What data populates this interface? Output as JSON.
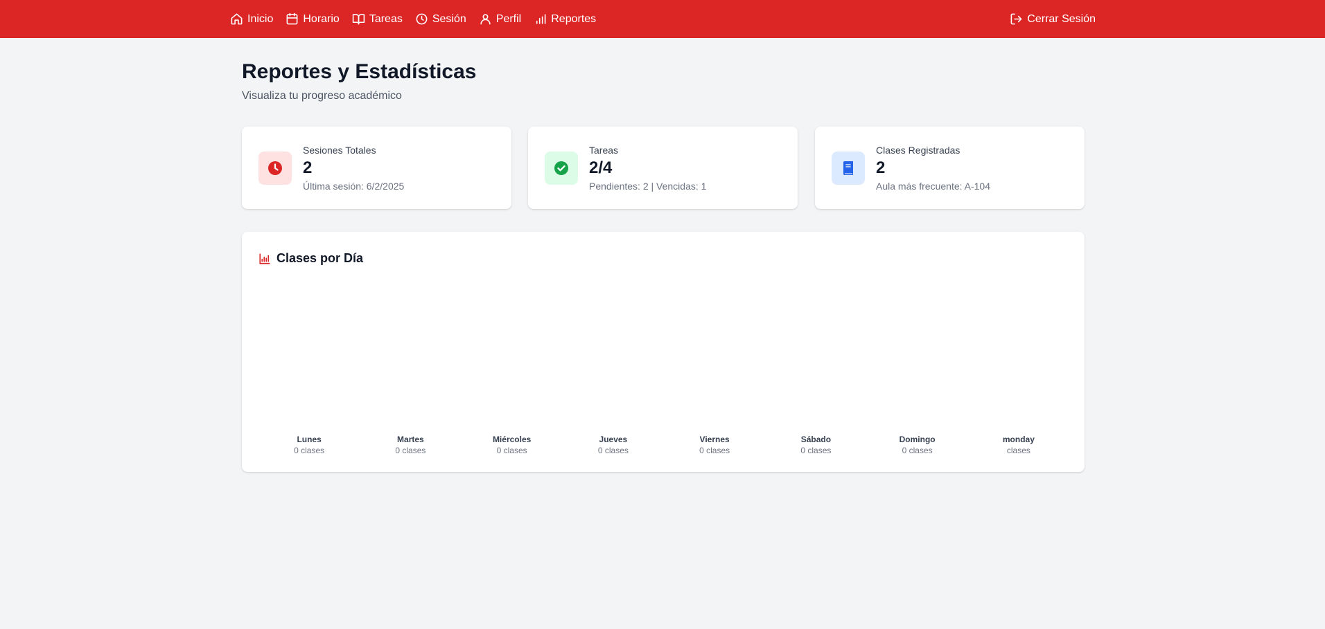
{
  "nav": {
    "items": [
      {
        "label": "Inicio",
        "icon": "home-icon"
      },
      {
        "label": "Horario",
        "icon": "calendar-icon"
      },
      {
        "label": "Tareas",
        "icon": "book-open-icon"
      },
      {
        "label": "Sesión",
        "icon": "clock-icon"
      },
      {
        "label": "Perfil",
        "icon": "user-icon"
      },
      {
        "label": "Reportes",
        "icon": "bar-chart-icon"
      }
    ],
    "logout_label": "Cerrar Sesión",
    "logout_icon": "logout-icon"
  },
  "header": {
    "title": "Reportes y Estadísticas",
    "subtitle": "Visualiza tu progreso académico"
  },
  "stats": [
    {
      "label": "Sesiones Totales",
      "value": "2",
      "sub": "Última sesión: 6/2/2025",
      "icon": "clock-icon"
    },
    {
      "label": "Tareas",
      "value": "2/4",
      "sub": "Pendientes: 2 | Vencidas: 1",
      "icon": "check-circle-icon"
    },
    {
      "label": "Clases Registradas",
      "value": "2",
      "sub": "Aula más frecuente: A-104",
      "icon": "book-icon"
    }
  ],
  "chart": {
    "title": "Clases por Día",
    "icon": "bar-chart-icon"
  },
  "chart_data": {
    "type": "bar",
    "title": "Clases por Día",
    "categories": [
      "Lunes",
      "Martes",
      "Miércoles",
      "Jueves",
      "Viernes",
      "Sábado",
      "Domingo",
      "monday"
    ],
    "values": [
      0,
      0,
      0,
      0,
      0,
      0,
      0,
      null
    ],
    "value_labels": [
      "0 clases",
      "0 clases",
      "0 clases",
      "0 clases",
      "0 clases",
      "0 clases",
      "0 clases",
      "clases"
    ]
  },
  "colors": {
    "nav_bg": "#dc2626",
    "page_bg": "#f3f4f6",
    "sessions_icon_bg": "#fee2e2",
    "sessions_icon": "#dc2626",
    "tasks_icon_bg": "#dcfce7",
    "tasks_icon": "#16a34a",
    "classes_icon_bg": "#dbeafe",
    "classes_icon": "#2563eb"
  }
}
